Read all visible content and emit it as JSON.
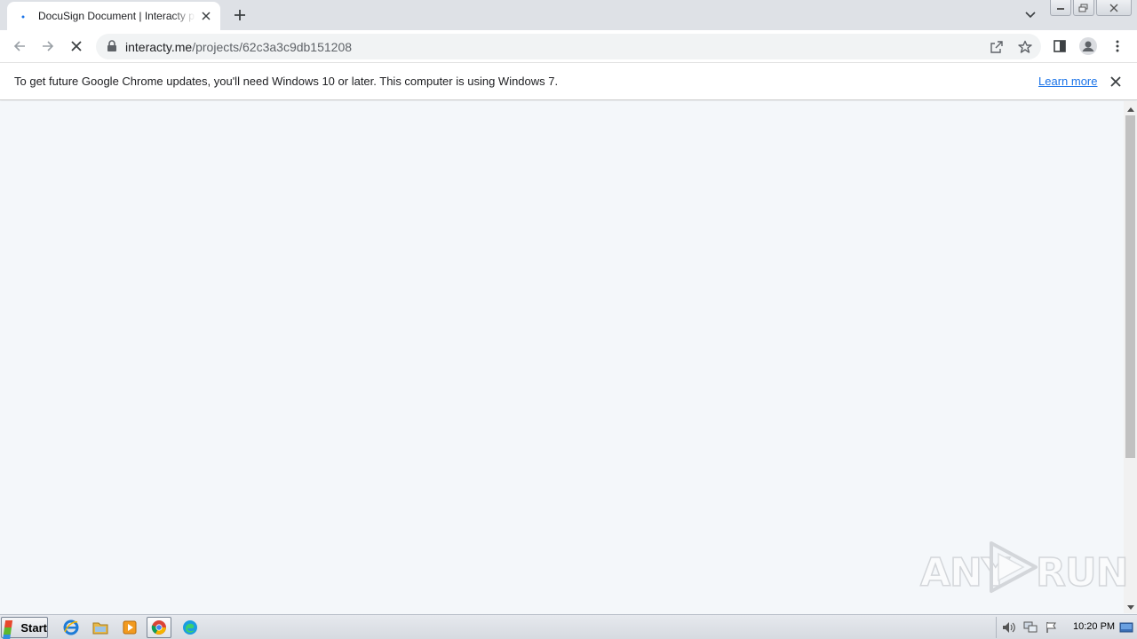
{
  "browser": {
    "tab": {
      "title": "DocuSign Document | Interacty project",
      "favicon": "loading-dot-icon"
    },
    "new_tab_icon": "plus-icon",
    "address": {
      "host": "interacty.me",
      "path": "/projects/62c3a3c9db151208"
    },
    "toolbar_icons": [
      "back-icon",
      "forward-icon",
      "stop-icon",
      "share-icon",
      "bookmark-star-icon",
      "side-panel-icon",
      "profile-icon",
      "menu-icon"
    ]
  },
  "infobar": {
    "message": "To get future Google Chrome updates, you'll need Windows 10 or later. This computer is using Windows 7.",
    "link": "Learn more"
  },
  "watermark": {
    "left": "ANY",
    "right": "RUN"
  },
  "taskbar": {
    "start_label": "Start",
    "apps": [
      "internet-explorer-icon",
      "file-explorer-icon",
      "media-player-icon",
      "chrome-icon",
      "edge-icon"
    ],
    "clock": "10:20 PM"
  },
  "colors": {
    "page_background": "#f4f7fa",
    "tab_strip": "#dee1e6",
    "link": "#1a73e8"
  }
}
